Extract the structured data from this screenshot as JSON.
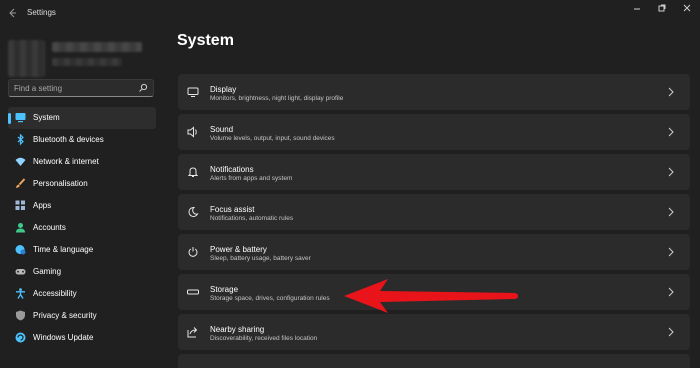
{
  "window": {
    "title": "Settings",
    "back_icon": "back-arrow-icon",
    "controls": [
      "minimize-icon",
      "maximize-icon",
      "close-icon"
    ]
  },
  "sidebar": {
    "search": {
      "placeholder": "Find a setting",
      "value": ""
    },
    "items": [
      {
        "label": "System",
        "icon": "monitor-icon",
        "selected": true,
        "icon_color": "#4cc2ff"
      },
      {
        "label": "Bluetooth & devices",
        "icon": "bluetooth-icon",
        "icon_color": "#4cc2ff"
      },
      {
        "label": "Network & internet",
        "icon": "wifi-icon",
        "icon_color": "#8fd4ff"
      },
      {
        "label": "Personalisation",
        "icon": "brush-icon",
        "icon_color": "#f0a35e"
      },
      {
        "label": "Apps",
        "icon": "apps-icon",
        "icon_color": "#9fb8d9"
      },
      {
        "label": "Accounts",
        "icon": "account-icon",
        "icon_color": "#3ec98a"
      },
      {
        "label": "Time & language",
        "icon": "globe-clock-icon",
        "icon_color": "#4cc2ff"
      },
      {
        "label": "Gaming",
        "icon": "gamepad-icon",
        "icon_color": "#b8b8b8"
      },
      {
        "label": "Accessibility",
        "icon": "accessibility-icon",
        "icon_color": "#4cc2ff"
      },
      {
        "label": "Privacy & security",
        "icon": "shield-icon",
        "icon_color": "#9a9a9a"
      },
      {
        "label": "Windows Update",
        "icon": "update-icon",
        "icon_color": "#4cc2ff"
      }
    ]
  },
  "main": {
    "title": "System",
    "cards": [
      {
        "title": "Display",
        "subtitle": "Monitors, brightness, night light, display profile",
        "icon": "display-icon"
      },
      {
        "title": "Sound",
        "subtitle": "Volume levels, output, input, sound devices",
        "icon": "speaker-icon"
      },
      {
        "title": "Notifications",
        "subtitle": "Alerts from apps and system",
        "icon": "bell-icon"
      },
      {
        "title": "Focus assist",
        "subtitle": "Notifications, automatic rules",
        "icon": "moon-icon"
      },
      {
        "title": "Power & battery",
        "subtitle": "Sleep, battery usage, battery saver",
        "icon": "power-icon"
      },
      {
        "title": "Storage",
        "subtitle": "Storage space, drives, configuration rules",
        "icon": "storage-icon"
      },
      {
        "title": "Nearby sharing",
        "subtitle": "Discoverability, received files location",
        "icon": "share-icon"
      }
    ]
  },
  "annotation": {
    "type": "arrow",
    "color": "#e8141a",
    "points_to": "Storage"
  },
  "colors": {
    "background": "#202020",
    "card": "#2b2b2b",
    "accent": "#4cc2ff"
  }
}
